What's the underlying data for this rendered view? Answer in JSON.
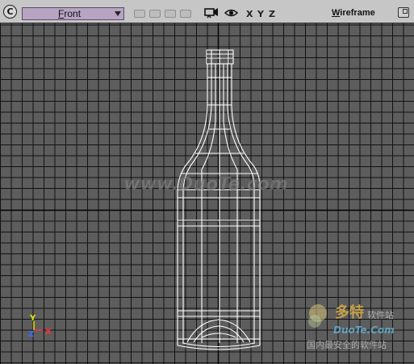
{
  "toolbar": {
    "viewport_menu_glyph": "C",
    "camera": "Front",
    "axes": [
      "X",
      "Y",
      "Z"
    ],
    "shading_mode": "Wireframe",
    "icons": [
      "viewport-menu-icon",
      "camera-dropdown-arrow-icon",
      "layout-button",
      "camera-view-icon",
      "eye-icon",
      "maximize-icon"
    ]
  },
  "axis_gizmo": {
    "y_label": "Y",
    "z_label": "Z",
    "x_label": "X",
    "y_color": "#e6e600",
    "z_color": "#3a6bff",
    "x_color": "#ff3030"
  },
  "scene": {
    "object": "bottle",
    "display": "wireframe",
    "grid_color": "#111111",
    "background": "#5d5d5d",
    "wire_color": "#ffffff"
  },
  "watermarks": {
    "center": "www.DuoTe.com",
    "logo_title": "多特",
    "logo_tag": "软件站",
    "logo_domain": "DuoTe.Com",
    "logo_slogan": "国内最安全的软件站"
  }
}
